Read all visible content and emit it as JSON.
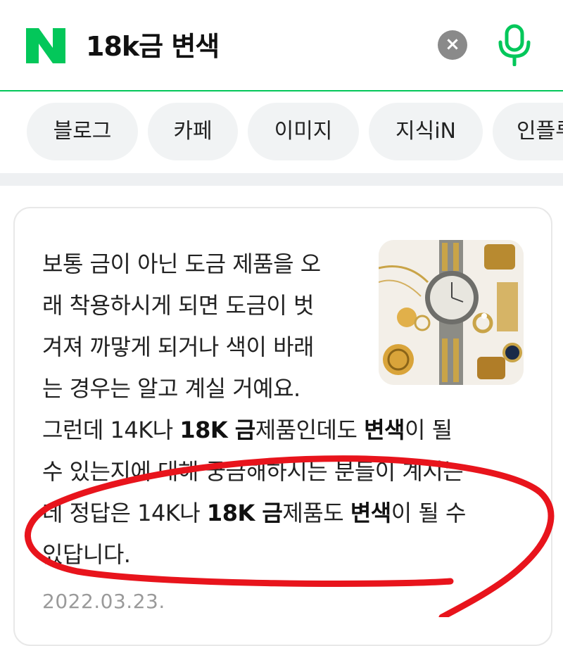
{
  "search": {
    "query": "18k금 변색",
    "clear_label": "×"
  },
  "tabs": [
    {
      "label": "블로그"
    },
    {
      "label": "카페"
    },
    {
      "label": "이미지"
    },
    {
      "label": "지식iN"
    },
    {
      "label": "인플루"
    }
  ],
  "result": {
    "lines": [
      "보통 금이 아닌 도금 제품을 오",
      "래 착용하시게 되면 도금이 벗",
      "겨져 까맣게 되거나 색이 바래",
      "는 경우는 알고 계실 거예요."
    ],
    "line5": {
      "a": "그런데 14K나 ",
      "b": "18K 금",
      "c": "제품인데도 ",
      "d": "변색",
      "e": "이 될"
    },
    "line6": "수 있는지에 대해 궁금해하시는 분들이 계시는",
    "line7": {
      "a": "데 정답은 14K나 ",
      "b": "18K 금",
      "c": "제품도 ",
      "d": "변색",
      "e": "이 될 수"
    },
    "line8": "있답니다.",
    "date": "2022.03.23."
  },
  "colors": {
    "brand": "#03c75a",
    "annotation": "#e8141c"
  },
  "icons": {
    "logo": "naver-n-logo",
    "clear": "clear-icon",
    "mic": "microphone-icon",
    "thumb": "jewelry-thumbnail"
  }
}
